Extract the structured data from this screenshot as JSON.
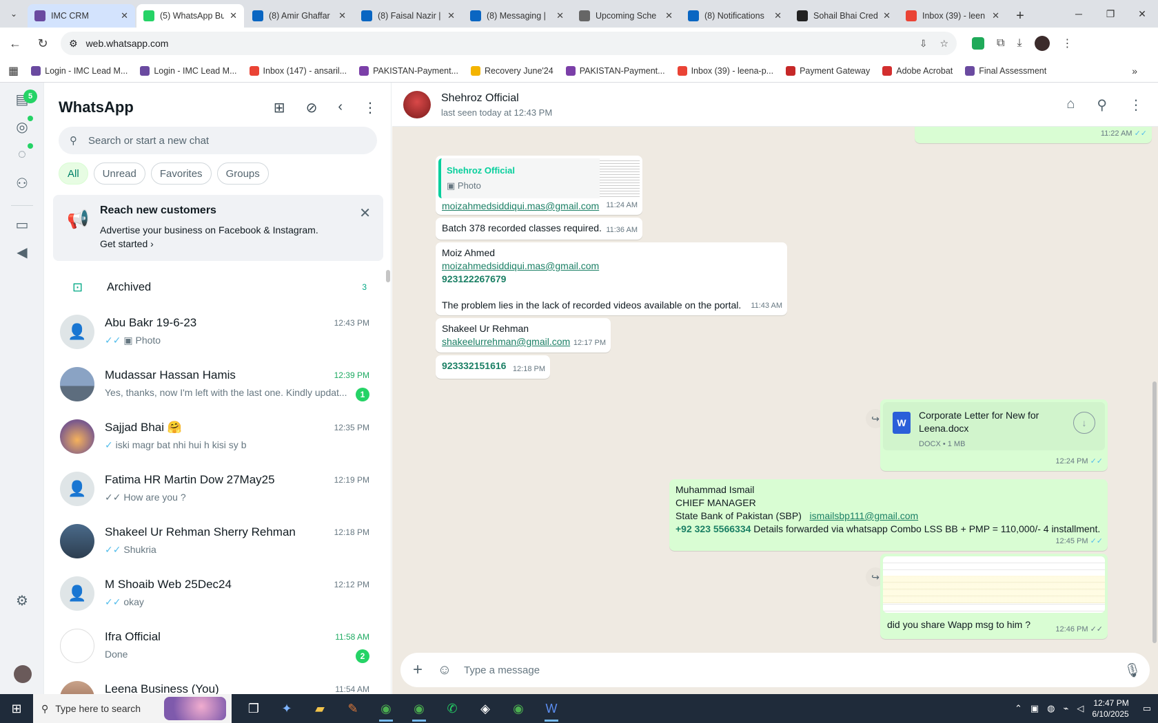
{
  "browser": {
    "tabs": [
      {
        "title": "IMC CRM",
        "icon": "crm-icon",
        "color": "#6a4aa0",
        "state": "group"
      },
      {
        "title": "(5) WhatsApp Bu",
        "icon": "whatsapp-icon",
        "color": "#25d366",
        "state": "active"
      },
      {
        "title": "(8) Amir Ghaffar",
        "icon": "linkedin-icon",
        "color": "#0a66c2"
      },
      {
        "title": "(8) Faisal Nazir |",
        "icon": "linkedin-icon",
        "color": "#0a66c2"
      },
      {
        "title": "(8) Messaging |",
        "icon": "linkedin-icon",
        "color": "#0a66c2"
      },
      {
        "title": "Upcoming Sche",
        "icon": "calendar-icon",
        "color": "#666666"
      },
      {
        "title": "(8) Notifications",
        "icon": "linkedin-icon",
        "color": "#0a66c2"
      },
      {
        "title": "Sohail Bhai Cred",
        "icon": "openai-icon",
        "color": "#222222"
      },
      {
        "title": "Inbox (39) - leen",
        "icon": "gmail-icon",
        "color": "#ea4335"
      }
    ],
    "url": "web.whatsapp.com",
    "bookmarks": [
      {
        "label": "Login - IMC Lead M...",
        "color": "#6a4aa0"
      },
      {
        "label": "Login - IMC Lead M...",
        "color": "#6a4aa0"
      },
      {
        "label": "Inbox (147) - ansaril...",
        "color": "#ea4335"
      },
      {
        "label": "PAKISTAN-Payment...",
        "color": "#7b3fa8"
      },
      {
        "label": "Recovery June'24",
        "color": "#f4b400"
      },
      {
        "label": "PAKISTAN-Payment...",
        "color": "#7b3fa8"
      },
      {
        "label": "Inbox (39) - leena-p...",
        "color": "#ea4335"
      },
      {
        "label": "Payment Gateway",
        "color": "#c62828"
      },
      {
        "label": "Adobe Acrobat",
        "color": "#d32f2f"
      },
      {
        "label": "Final Assessment",
        "color": "#6a4aa0"
      }
    ]
  },
  "whatsapp": {
    "rail": {
      "status_badge": "5"
    },
    "sidebar": {
      "title": "WhatsApp",
      "search_placeholder": "Search or start a new chat",
      "filters": [
        "All",
        "Unread",
        "Favorites",
        "Groups"
      ],
      "promo": {
        "title": "Reach new customers",
        "desc": "Advertise your business on Facebook & Instagram.",
        "link": "Get started"
      },
      "archived": {
        "label": "Archived",
        "count": "3"
      },
      "chats": [
        {
          "name": "Abu Bakr 19-6-23",
          "preview": "Photo",
          "time": "12:43 PM",
          "tick": "✓✓",
          "photo": true,
          "avatar": "default"
        },
        {
          "name": "Mudassar Hassan Hamis",
          "preview": "Yes, thanks, now I'm left with the last one.  Kindly updat...",
          "time": "12:39 PM",
          "unread": "1",
          "avatar": "mosque"
        },
        {
          "name": "Sajjad Bhai 🤗",
          "preview": "iski magr bat nhi hui h kisi sy b",
          "time": "12:35 PM",
          "tick": "✓",
          "avatar": "sunset"
        },
        {
          "name": "Fatima HR Martin Dow 27May25",
          "preview": "How are you ?",
          "time": "12:19 PM",
          "tick": "✓✓",
          "tick_grey": true,
          "avatar": "default"
        },
        {
          "name": "Shakeel Ur Rehman Sherry Rehman",
          "preview": "Shukria",
          "time": "12:18 PM",
          "tick": "✓✓",
          "avatar": "person"
        },
        {
          "name": "M Shoaib Web 25Dec24",
          "preview": "okay",
          "time": "12:12 PM",
          "tick": "✓✓",
          "avatar": "default"
        },
        {
          "name": "Ifra Official",
          "preview": "Done",
          "time": "11:58 AM",
          "unread": "2",
          "avatar": "logo"
        },
        {
          "name": "Leena Business (You)",
          "preview": "",
          "time": "11:54 AM",
          "avatar": "person2"
        }
      ]
    },
    "conversation": {
      "name": "Shehroz Official",
      "status": "last seen today at 12:43 PM",
      "messages": {
        "m0_time": "11:22 AM",
        "m1_quote_name": "Shehroz Official",
        "m1_quote_type": "Photo",
        "m1_email": "moizahmedsiddiqui.mas@gmail.com",
        "m1_time": "11:24 AM",
        "m2_text": "Batch 378 recorded classes required.",
        "m2_time": "11:36 AM",
        "m3_name": "Moiz Ahmed",
        "m3_email": "moizahmedsiddiqui.mas@gmail.com",
        "m3_phone": "923122267679",
        "m3_text": "The problem lies in the lack of recorded videos available on the portal.",
        "m3_time": "11:43 AM",
        "m4_name": "Shakeel Ur Rehman",
        "m4_email": "shakeelurrehman@gmail.com",
        "m4_time": "12:17 PM",
        "m5_phone": "923332151616",
        "m5_time": "12:18 PM",
        "m6_doc_name": "Corporate Letter for New for Leena.docx",
        "m6_doc_meta": "DOCX • 1 MB",
        "m6_time": "12:24 PM",
        "m7_line1": "Muhammad Ismail",
        "m7_line2": "CHIEF MANAGER",
        "m7_line3": "State Bank of Pakistan (SBP)",
        "m7_email": "ismailsbp111@gmail.com",
        "m7_phone": "+92 323 5566334",
        "m7_text": "Details forwarded via whatsapp Combo LSS BB + PMP = 110,000/- 4 installment.",
        "m7_time": "12:45 PM",
        "m8_text": "did you share Wapp msg to him ?",
        "m8_time": "12:46 PM"
      },
      "composer_placeholder": "Type a message"
    }
  },
  "taskbar": {
    "search_placeholder": "Type here to search",
    "time": "12:47 PM",
    "date": "6/10/2025"
  }
}
